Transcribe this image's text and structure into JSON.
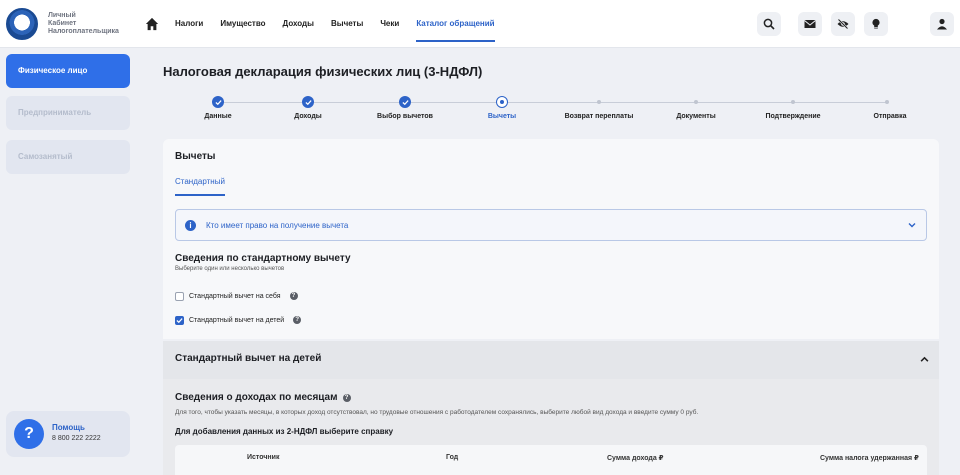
{
  "header": {
    "logo_text": [
      "Личный",
      "Кабинет",
      "Налогоплательщика"
    ],
    "nav": [
      "Налоги",
      "Имущество",
      "Доходы",
      "Вычеты",
      "Чеки",
      "Каталог обращений"
    ],
    "active_nav_index": 5,
    "icons": [
      "search-icon",
      "mail-icon",
      "eye-off-icon",
      "lightbulb-icon",
      "user-icon"
    ]
  },
  "sidebar": {
    "items": [
      {
        "label": "Физическое лицо",
        "active": true
      },
      {
        "label": "Предприниматель",
        "active": false
      },
      {
        "label": "Самозанятый",
        "active": false
      }
    ],
    "help": {
      "title": "Помощь",
      "phone": "8 800 222 2222",
      "icon": "?"
    }
  },
  "page_title": "Налоговая декларация физических лиц (3-НДФЛ)",
  "stepper": {
    "steps": [
      "Данные",
      "Доходы",
      "Выбор вычетов",
      "Вычеты",
      "Возврат переплаты",
      "Документы",
      "Подтверждение",
      "Отправка"
    ],
    "current_index": 3
  },
  "deductions": {
    "title": "Вычеты",
    "tab": "Стандартный",
    "accordion_label": "Кто имеет право на получение вычета",
    "section_title": "Сведения по стандартному вычету",
    "section_subtitle": "Выберите один или несколько вычетов",
    "options": [
      {
        "label": "Стандартный вычет на себя",
        "checked": false
      },
      {
        "label": "Стандартный вычет на детей",
        "checked": true
      }
    ]
  },
  "children_section": {
    "title": "Стандартный вычет на детей"
  },
  "income_section": {
    "title": "Сведения о доходах по месяцам",
    "note": "Для того, чтобы указать месяцы, в которых доход отсутствовал, но трудовые отношения с работодателем сохранялись, выберите любой вид дохода и введите сумму 0 руб.",
    "subtitle": "Для добавления данных из 2-НДФЛ выберите справку",
    "columns": [
      "Источник",
      "Год",
      "Сумма дохода ₽",
      "Сумма налога удержанная ₽"
    ]
  },
  "colors": {
    "accent": "#2d63c8",
    "sidebar_active": "#2f6fe8"
  }
}
